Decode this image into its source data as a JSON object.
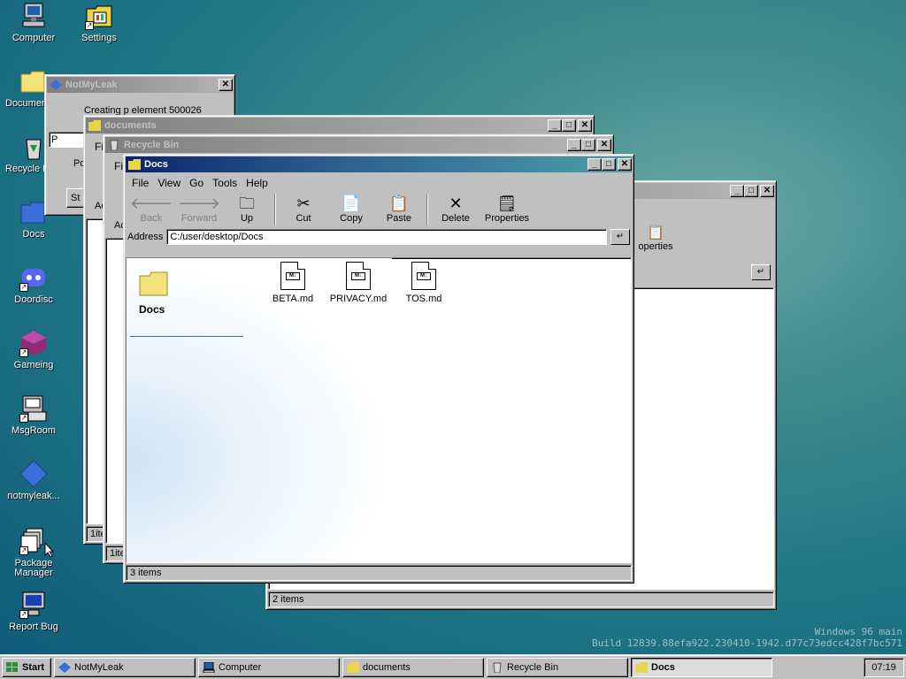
{
  "desktop": {
    "icons": [
      {
        "label": "Computer",
        "icon": "computer-icon"
      },
      {
        "label": "Settings",
        "icon": "settings-icon"
      },
      {
        "label": "Documents",
        "icon": "folder-icon"
      },
      {
        "label": "Recycle Bin",
        "icon": "recycle-bin-icon"
      },
      {
        "label": "Docs",
        "icon": "folder-icon"
      },
      {
        "label": "Doordisc",
        "icon": "doordisc-icon"
      },
      {
        "label": "Gameing",
        "icon": "gameing-icon"
      },
      {
        "label": "MsgRoom",
        "icon": "msgroom-icon"
      },
      {
        "label": "notmyleak...",
        "icon": "diamond-icon"
      },
      {
        "label": "Package Manager",
        "icon": "package-icon"
      },
      {
        "label": "Report Bug",
        "icon": "monitor-icon"
      }
    ]
  },
  "notmyleak_window": {
    "title": "NotMyLeak",
    "message": "Creating p element 500026",
    "input_value": "P",
    "label": "Po",
    "button": "St"
  },
  "documents_window": {
    "title": "documents",
    "menu_first": "Fi",
    "addr_first": "Ac",
    "status": "1ite"
  },
  "recycle_window": {
    "title": "Recycle Bin",
    "menu_first": "Fi",
    "addr_first": "Ac",
    "status": "1ite"
  },
  "back_window": {
    "toolbar_label": "operties",
    "status": "2 items"
  },
  "docs_window": {
    "title": "Docs",
    "menu": [
      "File",
      "View",
      "Go",
      "Tools",
      "Help"
    ],
    "toolbar": [
      {
        "label": "Back",
        "icon": "back-arrow-icon",
        "disabled": true
      },
      {
        "label": "Forward",
        "icon": "forward-arrow-icon",
        "disabled": true
      },
      {
        "label": "Up",
        "icon": "up-folder-icon",
        "disabled": false
      },
      {
        "label": "Cut",
        "icon": "scissors-icon",
        "disabled": false
      },
      {
        "label": "Copy",
        "icon": "copy-icon",
        "disabled": false
      },
      {
        "label": "Paste",
        "icon": "paste-icon",
        "disabled": false
      },
      {
        "label": "Delete",
        "icon": "delete-x-icon",
        "disabled": false
      },
      {
        "label": "Properties",
        "icon": "properties-icon",
        "disabled": false
      }
    ],
    "address_label": "Address",
    "address_value": "C:/user/desktop/Docs",
    "sidebar_title": "Docs",
    "files": [
      "BETA.md",
      "PRIVACY.md",
      "TOS.md"
    ],
    "file_badge": "M↓",
    "status": "3 items"
  },
  "taskbar": {
    "start": "Start",
    "items": [
      {
        "label": "NotMyLeak",
        "active": false
      },
      {
        "label": "Computer",
        "active": false
      },
      {
        "label": "documents",
        "active": false
      },
      {
        "label": "Recycle Bin",
        "active": false
      },
      {
        "label": "Docs",
        "active": true
      }
    ],
    "clock": "07:19"
  },
  "watermark": {
    "line1": "Windows 96 main",
    "line2": "Build 12839.88efa922.230410-1942.d77c73edcc428f7bc571"
  },
  "colors": {
    "titlebar_active": "#0a246a",
    "window_face": "#c0c0c0",
    "desktop": "#1f7585"
  }
}
